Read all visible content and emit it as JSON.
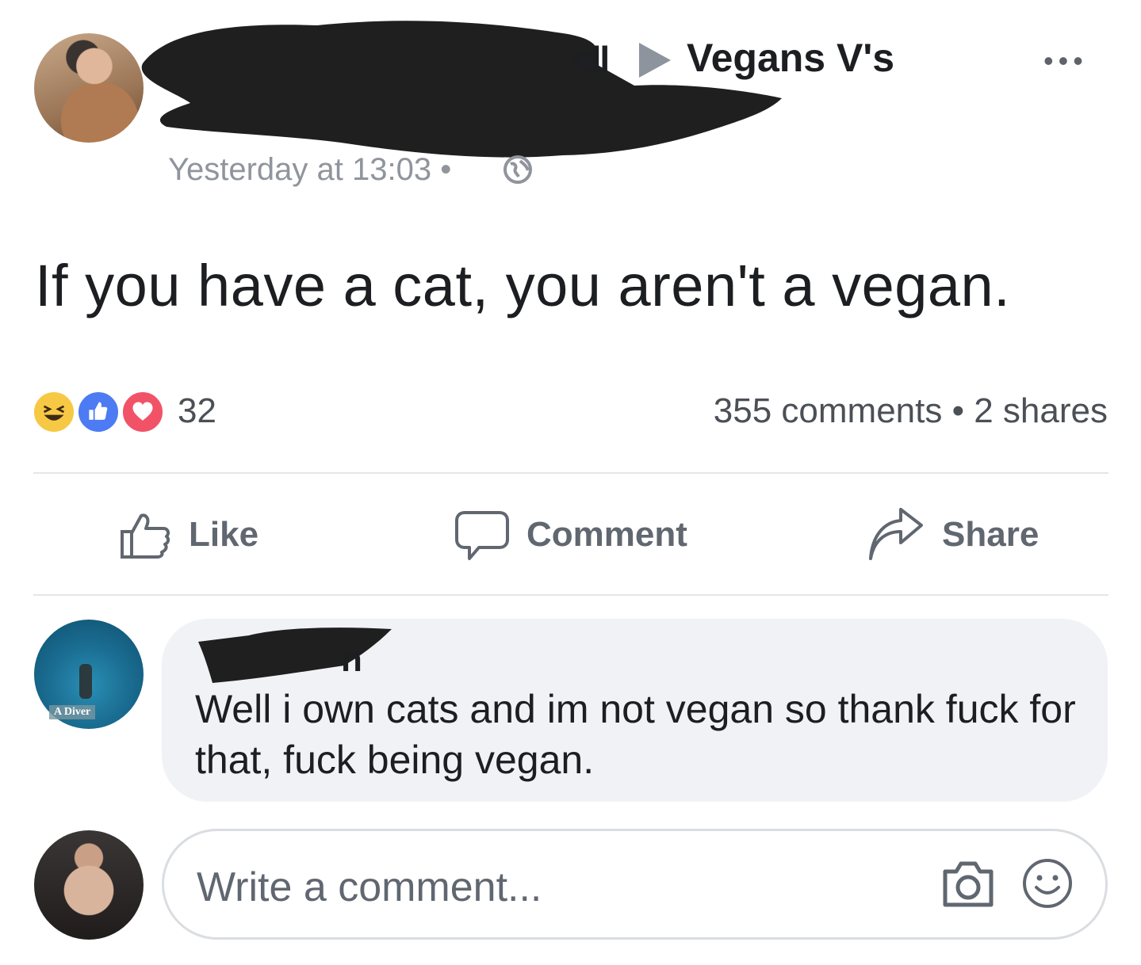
{
  "post": {
    "author_suffix": "ell",
    "group": "Vegans V's",
    "more": "•••",
    "timestamp": "Yesterday at 13:03 •",
    "text": "If you have a cat, you aren't a vegan."
  },
  "reactions": {
    "count": "32",
    "stats": "355 comments • 2 shares",
    "types": [
      "haha-icon",
      "like-icon",
      "love-icon"
    ],
    "colors": {
      "haha": "#f7c844",
      "like": "#4c7bf3",
      "love": "#f25268"
    }
  },
  "actions": {
    "like": "Like",
    "comment": "Comment",
    "share": "Share"
  },
  "comment": {
    "author_suffix": "n",
    "avatar_tag": "A Diver",
    "text": "Well i own cats and im not vegan so thank fuck for that, fuck being vegan."
  },
  "composer": {
    "placeholder": "Write a comment..."
  }
}
